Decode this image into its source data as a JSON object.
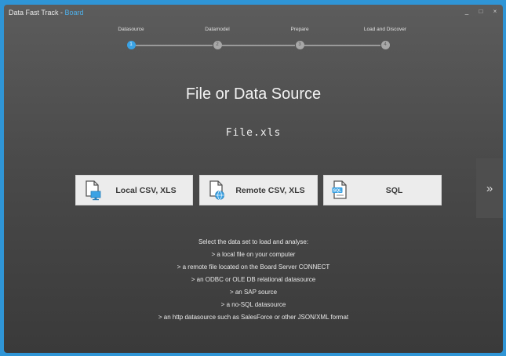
{
  "window": {
    "title_prefix": "Data Fast Track - ",
    "title_brand": "Board",
    "controls": {
      "minimize": "_",
      "maximize": "□",
      "close": "×"
    }
  },
  "steps": [
    {
      "label": "Datasource",
      "number": "1",
      "active": true
    },
    {
      "label": "Datamodel",
      "number": "2",
      "active": false
    },
    {
      "label": "Prepare",
      "number": "3",
      "active": false
    },
    {
      "label": "Load and Discover",
      "number": "4",
      "active": false
    }
  ],
  "main": {
    "heading": "File or Data Source",
    "filename": "File.xls"
  },
  "sources": {
    "local": {
      "label": "Local CSV, XLS",
      "icon": "local-file-monitor-icon"
    },
    "remote": {
      "label": "Remote CSV, XLS",
      "icon": "remote-file-globe-icon"
    },
    "sql": {
      "label": "SQL",
      "icon": "sql-database-icon",
      "badge": "SQL"
    }
  },
  "navigation": {
    "next": "»"
  },
  "description": [
    "Select the data set to load and analyse:",
    "> a local file on your computer",
    "> a remote file located on the Board Server CONNECT",
    "> an  ODBC or OLE DB  relational datasource",
    "> an SAP source",
    "> a no-SQL datasource",
    "> an http datasource such as SalesForce or other JSON/XML format"
  ],
  "colors": {
    "accent": "#3aa2e4",
    "background": "#2f95d6",
    "panel": "#4a4a4a",
    "button": "#ececec"
  }
}
